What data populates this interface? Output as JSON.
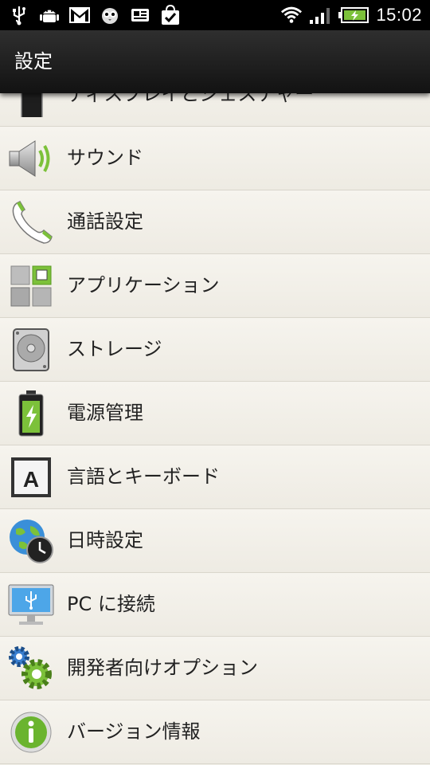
{
  "status_bar": {
    "time": "15:02",
    "left_icons": [
      "usb-icon",
      "android-debug-icon",
      "gmail-icon",
      "owl-icon",
      "news-icon",
      "shopping-bag-icon"
    ],
    "right_icons": [
      "wifi-icon",
      "signal-icon",
      "battery-charging-icon"
    ]
  },
  "titlebar": {
    "title": "設定"
  },
  "settings": {
    "items": [
      {
        "label": "ディスプレイとジェスチャー",
        "icon": "display-icon"
      },
      {
        "label": "サウンド",
        "icon": "speaker-icon"
      },
      {
        "label": "通話設定",
        "icon": "phone-icon"
      },
      {
        "label": "アプリケーション",
        "icon": "apps-icon"
      },
      {
        "label": "ストレージ",
        "icon": "storage-icon"
      },
      {
        "label": "電源管理",
        "icon": "battery-icon"
      },
      {
        "label": "言語とキーボード",
        "icon": "language-icon"
      },
      {
        "label": "日時設定",
        "icon": "globe-clock-icon"
      },
      {
        "label": "PC に接続",
        "icon": "pc-usb-icon"
      },
      {
        "label": "開発者向けオプション",
        "icon": "gears-icon"
      },
      {
        "label": "バージョン情報",
        "icon": "info-icon"
      }
    ]
  },
  "colors": {
    "accent_green": "#7cc13a",
    "background": "#f1efe8"
  }
}
